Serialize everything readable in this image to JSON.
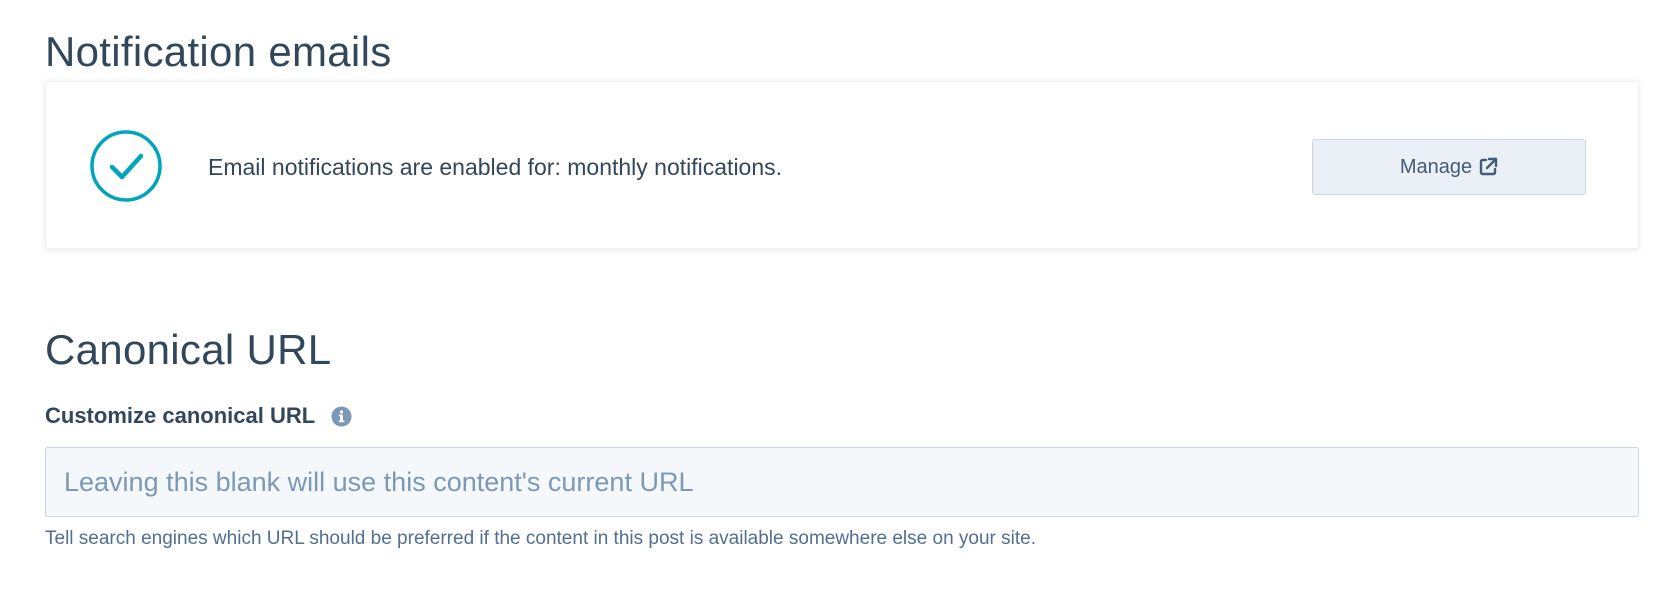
{
  "notifications": {
    "title": "Notification emails",
    "status_text": "Email notifications are enabled for: monthly notifications.",
    "manage_label": "Manage",
    "icons": {
      "status": "check-circle-icon",
      "manage": "external-link-icon"
    },
    "colors": {
      "check": "#00a4bd"
    }
  },
  "canonical": {
    "title": "Canonical URL",
    "field_label": "Customize canonical URL",
    "info_icon": "info-icon",
    "input_value": "",
    "input_placeholder": "Leaving this blank will use this content's current URL",
    "help_text": "Tell search engines which URL should be preferred if the content in this post is available somewhere else on your site."
  }
}
